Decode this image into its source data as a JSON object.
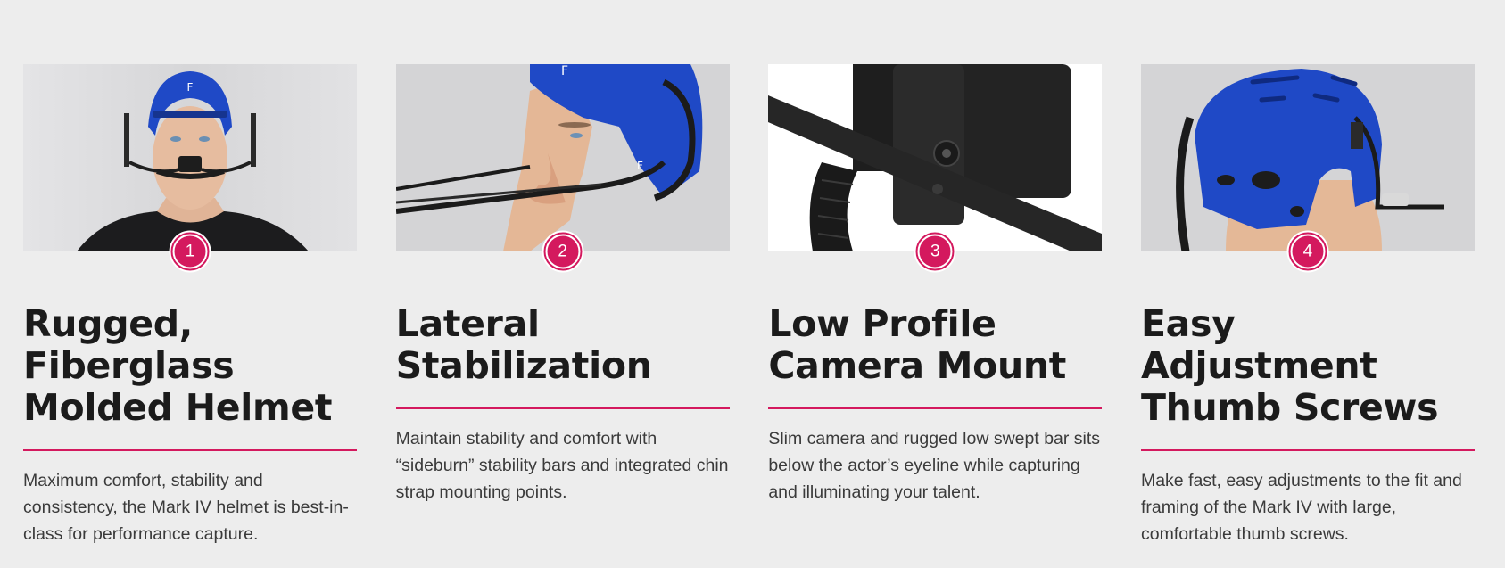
{
  "features": [
    {
      "number": "1",
      "image": "helmet-front-view",
      "title": "Rugged, Fiberglass Molded Helmet",
      "description": "Maximum comfort, stability and consistency, the Mark IV helmet is best-in-class for performance capture."
    },
    {
      "number": "2",
      "image": "helmet-side-view-stabilization-bars",
      "title": "Lateral Stabilization",
      "description": "Maintain stability and comfort with “sideburn” stability bars and integrated chin strap mounting points."
    },
    {
      "number": "3",
      "image": "camera-mount-closeup",
      "title": "Low Profile Camera Mount",
      "description": "Slim camera and rugged low swept bar sits below the actor’s eyeline while capturing and illuminating your talent."
    },
    {
      "number": "4",
      "image": "helmet-rear-view-thumb-screws",
      "title": "Easy Adjustment Thumb Screws",
      "description": "Make fast, easy adjustments to the fit and framing of the Mark IV with large, comfortable thumb screws."
    }
  ],
  "colors": {
    "accent": "#d4195e",
    "background": "#ededed",
    "heading": "#1b1b1b",
    "body": "#3a3a3a",
    "helmet": "#1f49c6"
  }
}
